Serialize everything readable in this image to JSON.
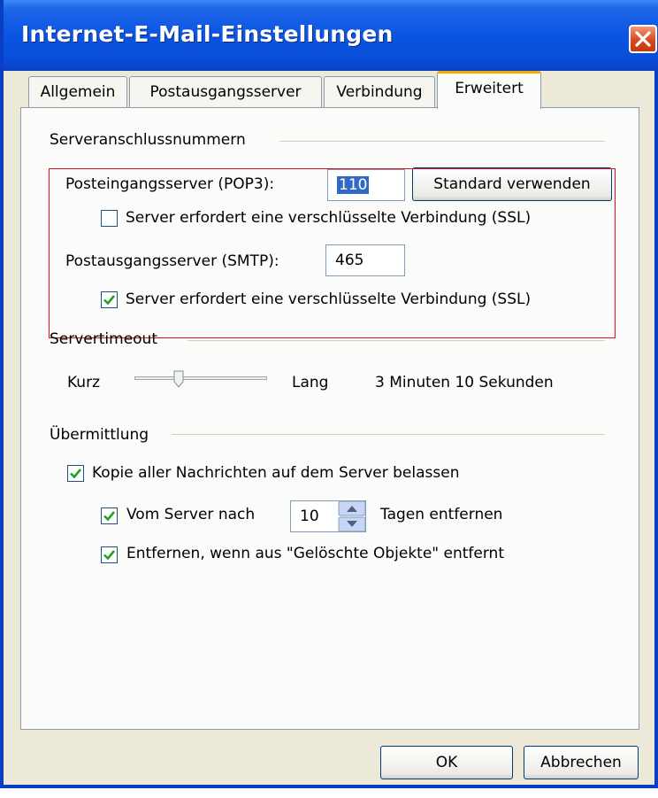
{
  "dialog": {
    "title": "Internet-E-Mail-Einstellungen"
  },
  "tabs": [
    {
      "label": "Allgemein",
      "active": false
    },
    {
      "label": "Postausgangsserver",
      "active": false
    },
    {
      "label": "Verbindung",
      "active": false
    },
    {
      "label": "Erweitert",
      "active": true
    }
  ],
  "server_ports": {
    "group_label": "Serveranschlussnummern",
    "incoming_label": "Posteingangsserver (POP3):",
    "incoming_value": "110",
    "use_default_label": "Standard verwenden",
    "incoming_ssl_label": "Server erfordert eine verschlüsselte Verbindung (SSL)",
    "incoming_ssl_checked": false,
    "outgoing_label": "Postausgangsserver (SMTP):",
    "outgoing_value": "465",
    "outgoing_ssl_label": "Server erfordert eine verschlüsselte Verbindung (SSL)",
    "outgoing_ssl_checked": true
  },
  "timeout": {
    "group_label": "Servertimeout",
    "short_label": "Kurz",
    "long_label": "Lang",
    "value_text": "3 Minuten 10 Sekunden"
  },
  "delivery": {
    "group_label": "Übermittlung",
    "keep_copy_label": "Kopie aller Nachrichten auf dem Server belassen",
    "keep_copy_checked": true,
    "remove_after_label": "Vom Server nach",
    "remove_after_checked": true,
    "days_value": "10",
    "days_suffix": "Tagen entfernen",
    "remove_deleted_label": "Entfernen, wenn aus \"Gelöschte Objekte\" entfernt",
    "remove_deleted_checked": true
  },
  "buttons": {
    "ok": "OK",
    "cancel": "Abbrechen"
  },
  "colors": {
    "titlebar": "#0a55e3",
    "highlight_box": "#e0101a",
    "check": "#21a121",
    "active_tab_accent": "#f8a900"
  }
}
